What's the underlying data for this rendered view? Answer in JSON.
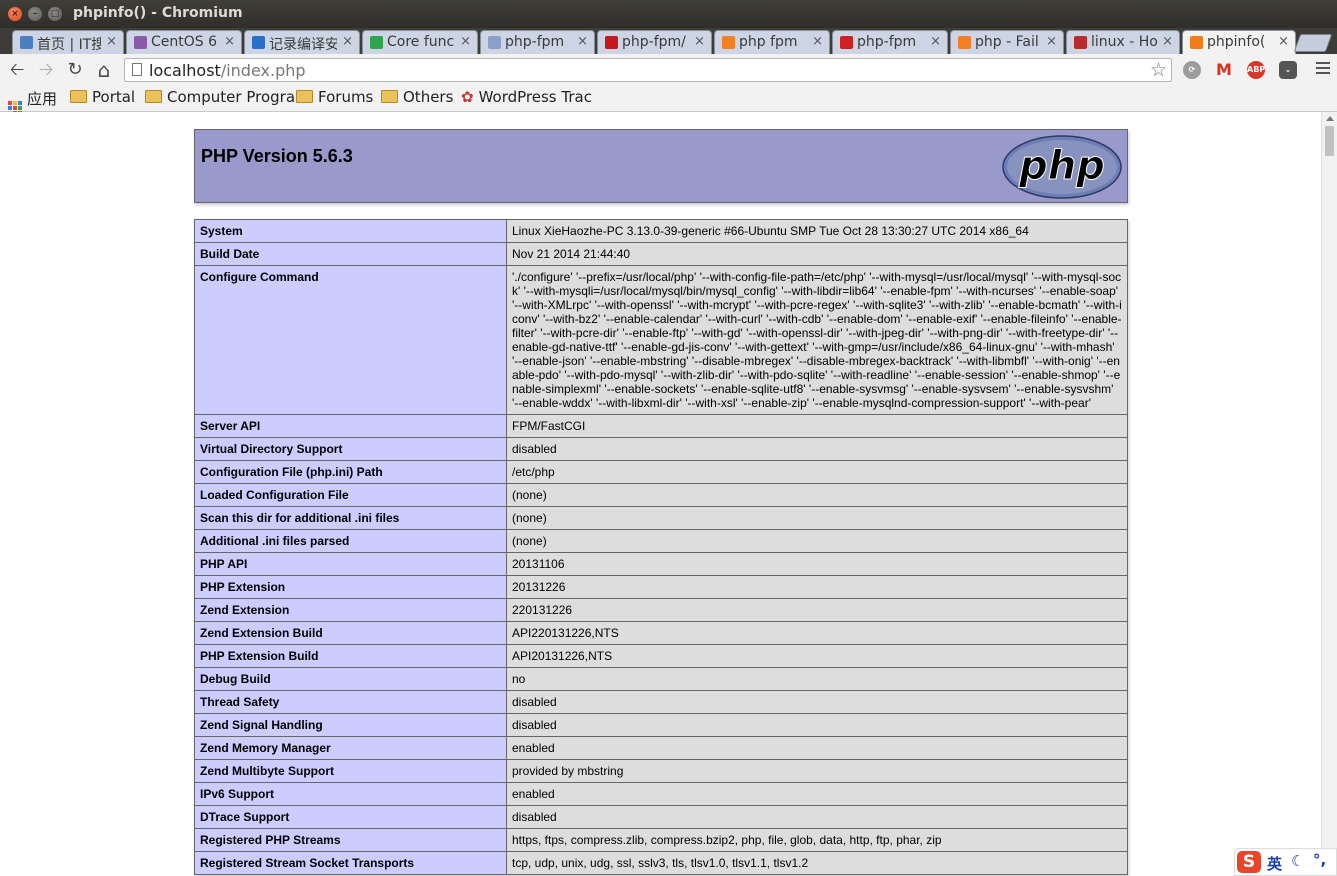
{
  "window": {
    "title": "phpinfo() - Chromium"
  },
  "tabs": [
    {
      "label": "首页 | IT搜",
      "icon": "it-icon",
      "color": "#4a7fc1"
    },
    {
      "label": "CentOS 6",
      "icon": "centos-icon",
      "color": "#8a5ca8"
    },
    {
      "label": "记录编译安",
      "icon": "blog-icon",
      "color": "#2a6fc9"
    },
    {
      "label": "Core func",
      "icon": "core-icon",
      "color": "#2ea44f"
    },
    {
      "label": "php-fpm",
      "icon": "loading-icon",
      "color": "#8aa0c8"
    },
    {
      "label": "php-fpm/",
      "icon": "csdn-icon",
      "color": "#c8161d"
    },
    {
      "label": "php fpm",
      "icon": "stackoverflow-icon",
      "color": "#f48024"
    },
    {
      "label": "php-fpm",
      "icon": "rainbow-icon",
      "color": "#cc2222"
    },
    {
      "label": "php - Fail",
      "icon": "stackoverflow-icon",
      "color": "#f48024"
    },
    {
      "label": "linux - Ho",
      "icon": "serverfault-icon",
      "color": "#b92d2d"
    },
    {
      "label": "phpinfo(",
      "icon": "xampp-icon",
      "color": "#f07d1a"
    }
  ],
  "toolbar": {
    "url_host": "localhost",
    "url_path": "/index.php"
  },
  "bookmarks": [
    {
      "label": "应用"
    },
    {
      "label": "Portal"
    },
    {
      "label": "Computer Progra"
    },
    {
      "label": "Forums"
    },
    {
      "label": "Others"
    },
    {
      "label": "WordPress Trac"
    }
  ],
  "page": {
    "php_version": "PHP Version 5.6.3",
    "logo_text": "php",
    "rows": [
      {
        "key": "System",
        "value": "Linux XieHaozhe-PC 3.13.0-39-generic #66-Ubuntu SMP Tue Oct 28 13:30:27 UTC 2014 x86_64"
      },
      {
        "key": "Build Date",
        "value": "Nov 21 2014 21:44:40"
      },
      {
        "key": "Configure Command",
        "value": "'./configure' '--prefix=/usr/local/php' '--with-config-file-path=/etc/php' '--with-mysql=/usr/local/mysql' '--with-mysql-sock' '--with-mysqli=/usr/local/mysql/bin/mysql_config' '--with-libdir=lib64' '--enable-fpm' '--with-ncurses' '--enable-soap' '--with-XMLrpc' '--with-openssl' '--with-mcrypt' '--with-pcre-regex' '--with-sqlite3' '--with-zlib' '--enable-bcmath' '--with-iconv' '--with-bz2' '--enable-calendar' '--with-curl' '--with-cdb' '--enable-dom' '--enable-exif' '--enable-fileinfo' '--enable-filter' '--with-pcre-dir' '--enable-ftp' '--with-gd' '--with-openssl-dir' '--with-jpeg-dir' '--with-png-dir' '--with-freetype-dir' '--enable-gd-native-ttf' '--enable-gd-jis-conv' '--with-gettext' '--with-gmp=/usr/include/x86_64-linux-gnu' '--with-mhash' '--enable-json' '--enable-mbstring' '--disable-mbregex' '--disable-mbregex-backtrack' '--with-libmbfl' '--with-onig' '--enable-pdo' '--with-pdo-mysql' '--with-zlib-dir' '--with-pdo-sqlite' '--with-readline' '--enable-session' '--enable-shmop' '--enable-simplexml' '--enable-sockets' '--enable-sqlite-utf8' '--enable-sysvmsg' '--enable-sysvsem' '--enable-sysvshm' '--enable-wddx' '--with-libxml-dir' '--with-xsl' '--enable-zip' '--enable-mysqlnd-compression-support' '--with-pear'"
      },
      {
        "key": "Server API",
        "value": "FPM/FastCGI"
      },
      {
        "key": "Virtual Directory Support",
        "value": "disabled"
      },
      {
        "key": "Configuration File (php.ini) Path",
        "value": "/etc/php"
      },
      {
        "key": "Loaded Configuration File",
        "value": "(none)"
      },
      {
        "key": "Scan this dir for additional .ini files",
        "value": "(none)"
      },
      {
        "key": "Additional .ini files parsed",
        "value": "(none)"
      },
      {
        "key": "PHP API",
        "value": "20131106"
      },
      {
        "key": "PHP Extension",
        "value": "20131226"
      },
      {
        "key": "Zend Extension",
        "value": "220131226"
      },
      {
        "key": "Zend Extension Build",
        "value": "API220131226,NTS"
      },
      {
        "key": "PHP Extension Build",
        "value": "API20131226,NTS"
      },
      {
        "key": "Debug Build",
        "value": "no"
      },
      {
        "key": "Thread Safety",
        "value": "disabled"
      },
      {
        "key": "Zend Signal Handling",
        "value": "disabled"
      },
      {
        "key": "Zend Memory Manager",
        "value": "enabled"
      },
      {
        "key": "Zend Multibyte Support",
        "value": "provided by mbstring"
      },
      {
        "key": "IPv6 Support",
        "value": "enabled"
      },
      {
        "key": "DTrace Support",
        "value": "disabled"
      },
      {
        "key": "Registered PHP Streams",
        "value": "https, ftps, compress.zlib, compress.bzip2, php, file, glob, data, http, ftp, phar, zip"
      },
      {
        "key": "Registered Stream Socket Transports",
        "value": "tcp, udp, unix, udg, ssl, sslv3, tls, tlsv1.0, tlsv1.1, tlsv1.2"
      }
    ]
  },
  "ime": {
    "badge": "S",
    "lang": "英"
  }
}
